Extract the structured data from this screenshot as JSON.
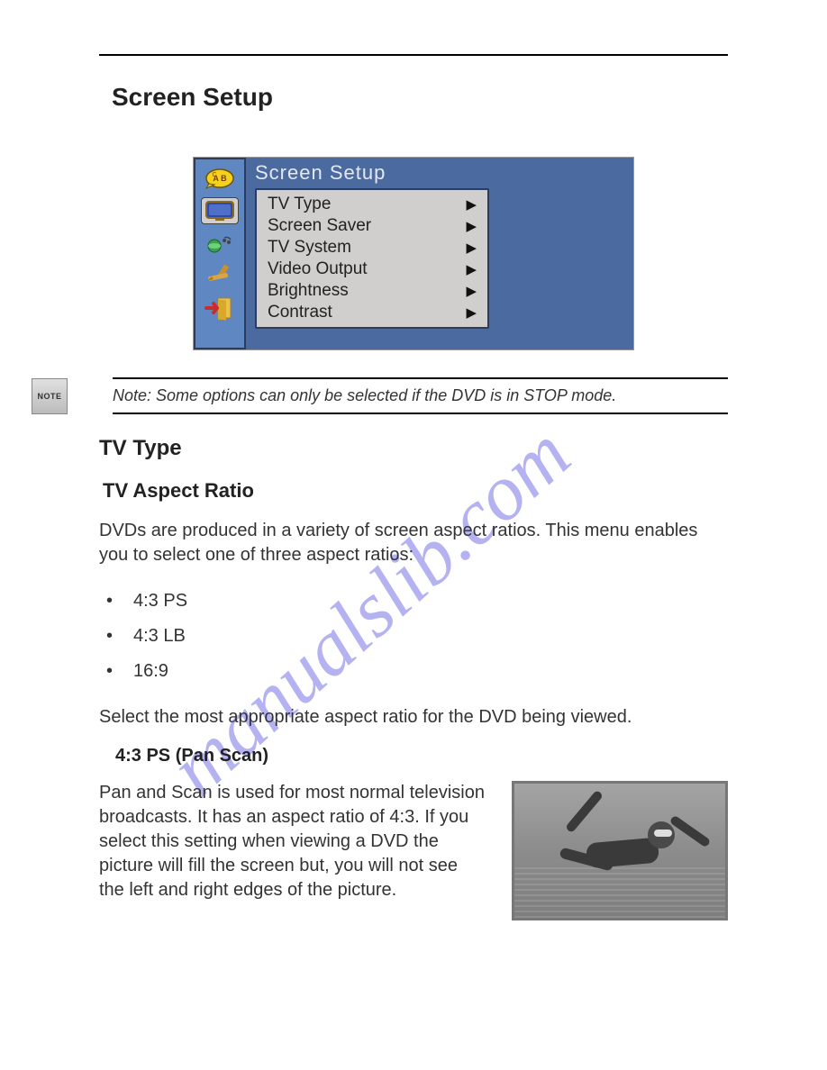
{
  "heading": "Screen Setup",
  "osd": {
    "title": "Screen  Setup",
    "items": [
      {
        "label": "TV Type"
      },
      {
        "label": "Screen Saver"
      },
      {
        "label": "TV System"
      },
      {
        "label": "Video Output"
      },
      {
        "label": "Brightness"
      },
      {
        "label": "Contrast"
      }
    ]
  },
  "note": {
    "badge": "NOTE",
    "text": "Note: Some options can only be selected if the DVD is in STOP mode."
  },
  "section": {
    "h2": "TV Type",
    "h3": "TV Aspect Ratio",
    "intro": "DVDs are produced in a variety of screen aspect ratios. This menu enables you to select one of three aspect ratios:",
    "bullets": [
      "4:3  PS",
      "4:3  LB",
      "16:9"
    ],
    "after": "Select the most appropriate aspect ratio for the DVD being viewed.",
    "item_heading": "4:3  PS (Pan Scan)",
    "item_body": "Pan and Scan is used for most normal television broadcasts. It has an aspect ratio of 4:3. If you select this setting when viewing a DVD the picture will fill the screen but, you will not see the left and right edges of the picture."
  },
  "watermark": "manualslib.com"
}
